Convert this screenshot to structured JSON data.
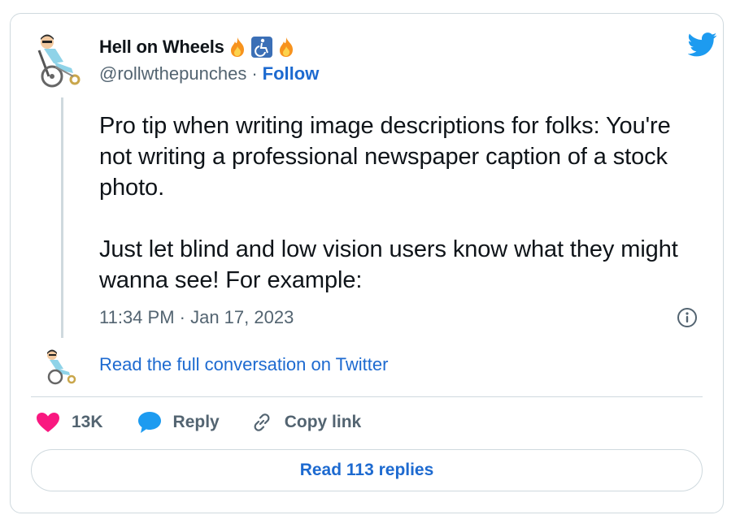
{
  "author": {
    "name": "Hell on Wheels",
    "handle": "@rollwthepunches",
    "separator": "·",
    "follow_label": "Follow",
    "name_emoji": [
      "fire-icon",
      "wheelchair-symbol-icon",
      "fire-icon"
    ]
  },
  "tweet": {
    "text": "Pro tip when writing image descriptions for folks: You're not writing a professional newspaper caption of a stock photo.\n\nJust let blind and low vision users know what they might wanna see! For example:",
    "timestamp": "11:34 PM · Jan 17, 2023"
  },
  "conversation_link": "Read the full conversation on Twitter",
  "actions": {
    "like_count": "13K",
    "reply_label": "Reply",
    "copy_link_label": "Copy link"
  },
  "replies_button": "Read 113 replies",
  "colors": {
    "link_blue": "#1d6ad0",
    "twitter_blue": "#1d9bf0",
    "like_pink": "#f91880",
    "muted_gray": "#536471",
    "border": "#cfd9de"
  }
}
